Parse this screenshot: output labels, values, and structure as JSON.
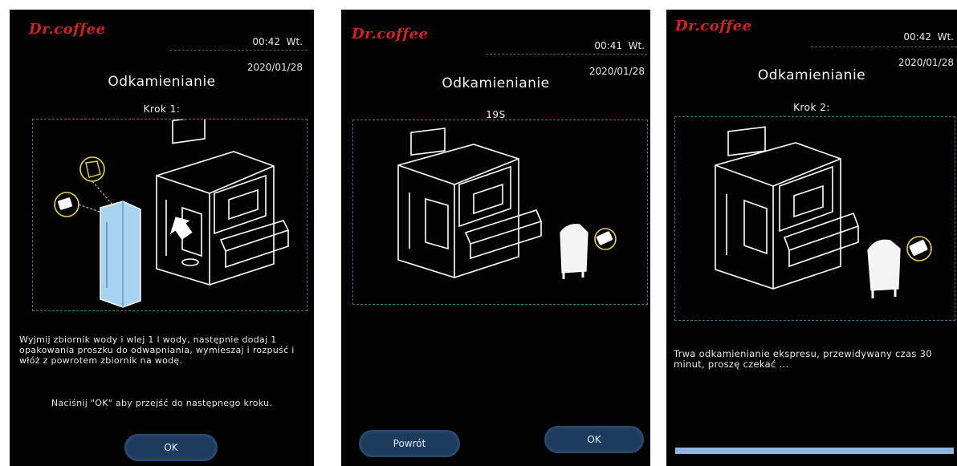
{
  "panels": [
    {
      "brand": "Dr.coffee",
      "time": "00:42  Wt.",
      "date": "2020/01/28",
      "title": "Odkamienianie",
      "subtitle": "Krok 1:",
      "instruction": "Wyjmij zbiornik wody i wlej 1 l wody, następnie dodaj 1 opakowania proszku do odwapniania, wymieszaj i rozpuść i włóż z powrotem zbiornik na wodę.",
      "hint": "Naciśnij \"OK\" aby przejść do następnego kroku.",
      "ok_label": "OK"
    },
    {
      "brand": "Dr.coffee",
      "time": "00:41  Wt.",
      "date": "2020/01/28",
      "title": "Odkamienianie",
      "subtitle": "19S",
      "back_label": "Powrót",
      "ok_label": "OK"
    },
    {
      "brand": "Dr.coffee",
      "time": "00:42  Wt.",
      "date": "2020/01/28",
      "title": "Odkamienianie",
      "subtitle": "Krok 2:",
      "instruction": "Trwa odkamienianie ekspresu, przewidywany czas 30 minut, proszę czekać ...",
      "progress": 1.0
    }
  ],
  "colors": {
    "brand": "#d81e1e",
    "button": "#1d3b5c",
    "line_art": "#ffffff",
    "tank": "#a8d4f2",
    "progress": "#8fb6e0"
  },
  "icons": [
    "coffee-machine-illustration",
    "water-tank-illustration",
    "descaling-powder-icon",
    "sachet-icon",
    "arrow-icon",
    "milk-jug-illustration"
  ]
}
